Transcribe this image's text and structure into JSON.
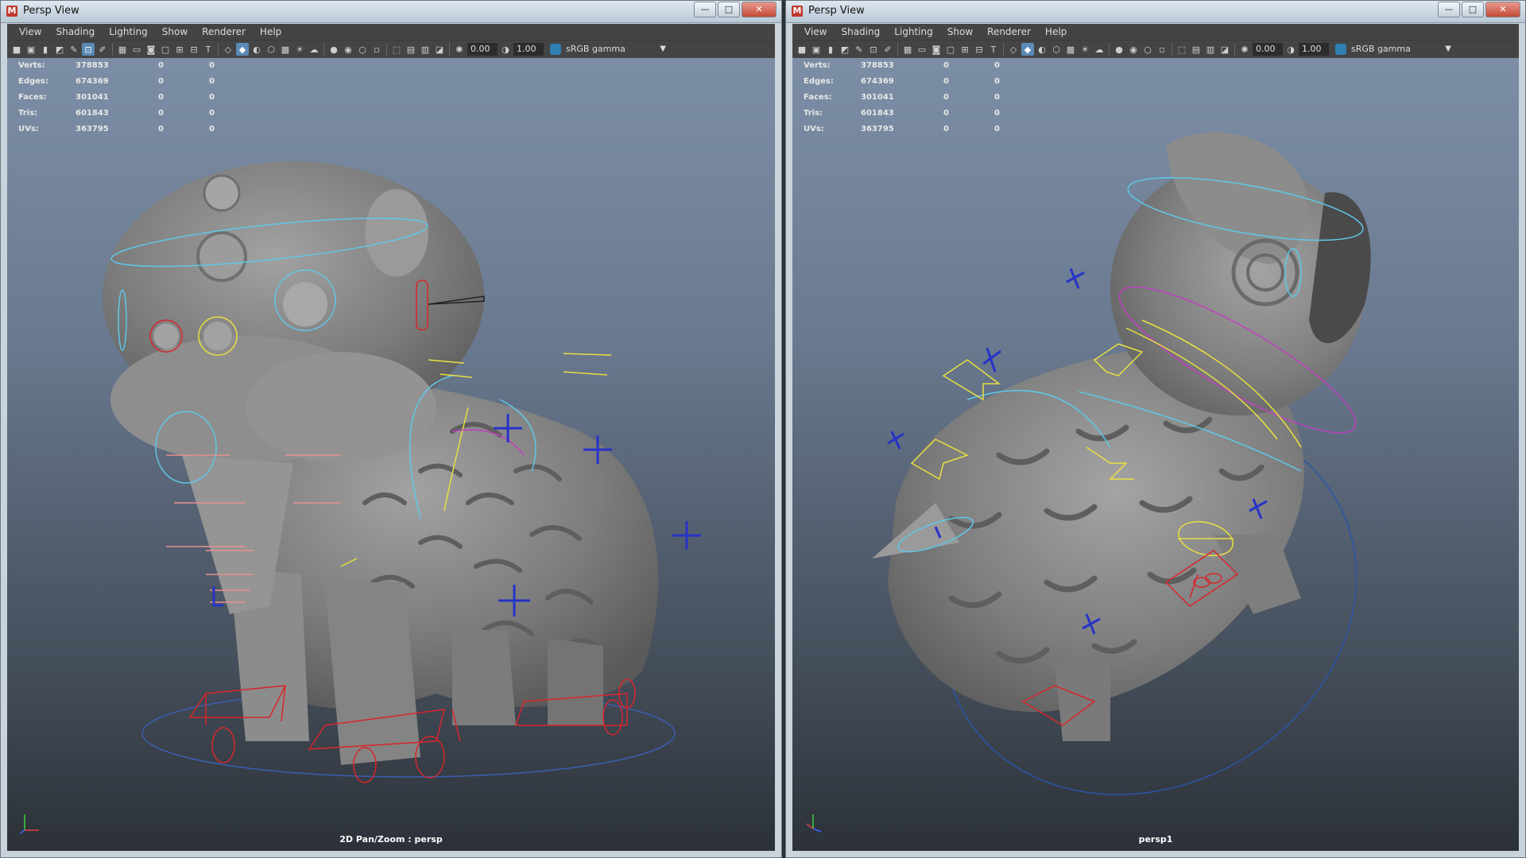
{
  "left": {
    "title": "Persp View",
    "menus": [
      "View",
      "Shading",
      "Lighting",
      "Show",
      "Renderer",
      "Help"
    ],
    "near": "0.00",
    "far": "1.00",
    "color_space": "sRGB gamma",
    "stats": [
      {
        "label": "Verts:",
        "v1": "378853",
        "v2": "0",
        "v3": "0"
      },
      {
        "label": "Edges:",
        "v1": "674369",
        "v2": "0",
        "v3": "0"
      },
      {
        "label": "Faces:",
        "v1": "301041",
        "v2": "0",
        "v3": "0"
      },
      {
        "label": "Tris:",
        "v1": "601843",
        "v2": "0",
        "v3": "0"
      },
      {
        "label": "UVs:",
        "v1": "363795",
        "v2": "0",
        "v3": "0"
      }
    ],
    "camera": "2D Pan/Zoom : persp"
  },
  "right": {
    "title": "Persp View",
    "menus": [
      "View",
      "Shading",
      "Lighting",
      "Show",
      "Renderer",
      "Help"
    ],
    "near": "0.00",
    "far": "1.00",
    "color_space": "sRGB gamma",
    "stats": [
      {
        "label": "Verts:",
        "v1": "378853",
        "v2": "0",
        "v3": "0"
      },
      {
        "label": "Edges:",
        "v1": "674369",
        "v2": "0",
        "v3": "0"
      },
      {
        "label": "Faces:",
        "v1": "301041",
        "v2": "0",
        "v3": "0"
      },
      {
        "label": "Tris:",
        "v1": "601843",
        "v2": "0",
        "v3": "0"
      },
      {
        "label": "UVs:",
        "v1": "363795",
        "v2": "0",
        "v3": "0"
      }
    ],
    "camera": "persp1"
  },
  "window_buttons": {
    "minimize": "—",
    "maximize": "□",
    "close": "✕"
  },
  "app_icon_letter": "M",
  "colors": {
    "rig_red": "#d8262b",
    "rig_cyan": "#5fc8e8",
    "rig_yellow": "#e8e040",
    "rig_blue": "#2633c8",
    "rig_magenta": "#c040c0",
    "mesh_gray": "#7c7c7c"
  }
}
